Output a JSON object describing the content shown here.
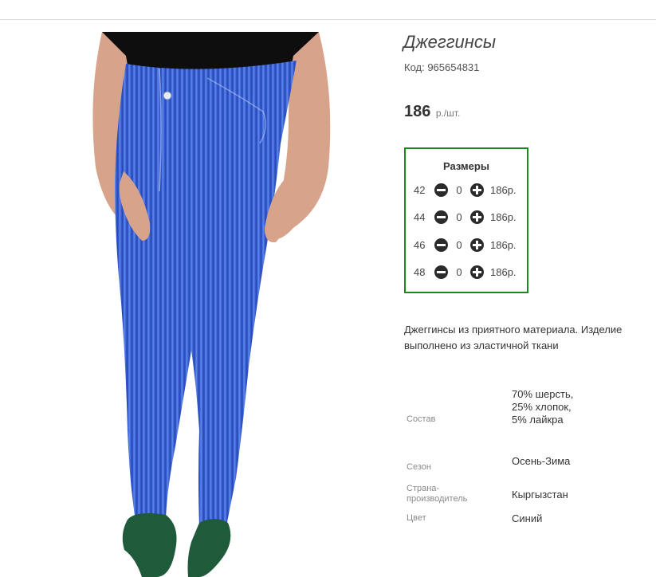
{
  "product": {
    "title": "Джеггинсы",
    "sku": "Код: 965654831",
    "price_value": "186",
    "price_unit": "р./шт."
  },
  "sizes": {
    "title": "Размеры",
    "rows": [
      {
        "size": "42",
        "qty": "0",
        "price": "186р."
      },
      {
        "size": "44",
        "qty": "0",
        "price": "186р."
      },
      {
        "size": "46",
        "qty": "0",
        "price": "186р."
      },
      {
        "size": "48",
        "qty": "0",
        "price": "186р."
      }
    ],
    "border_color": "#1a8a1a"
  },
  "description": "Джеггинсы из приятного материала. Изделие выполнено из эластичной ткани",
  "attributes": [
    {
      "label": "Состав",
      "value": "70% шерсть, 25% хлопок, 5% лайкра"
    },
    {
      "label": "Сезон",
      "value": "Осень-Зима"
    },
    {
      "label": "Страна-производитель",
      "value": "Кыргызстан"
    },
    {
      "label": "Цвет",
      "value": "Синий"
    }
  ],
  "icons": {
    "minus": "minus-circle-icon",
    "plus": "plus-circle-icon"
  }
}
